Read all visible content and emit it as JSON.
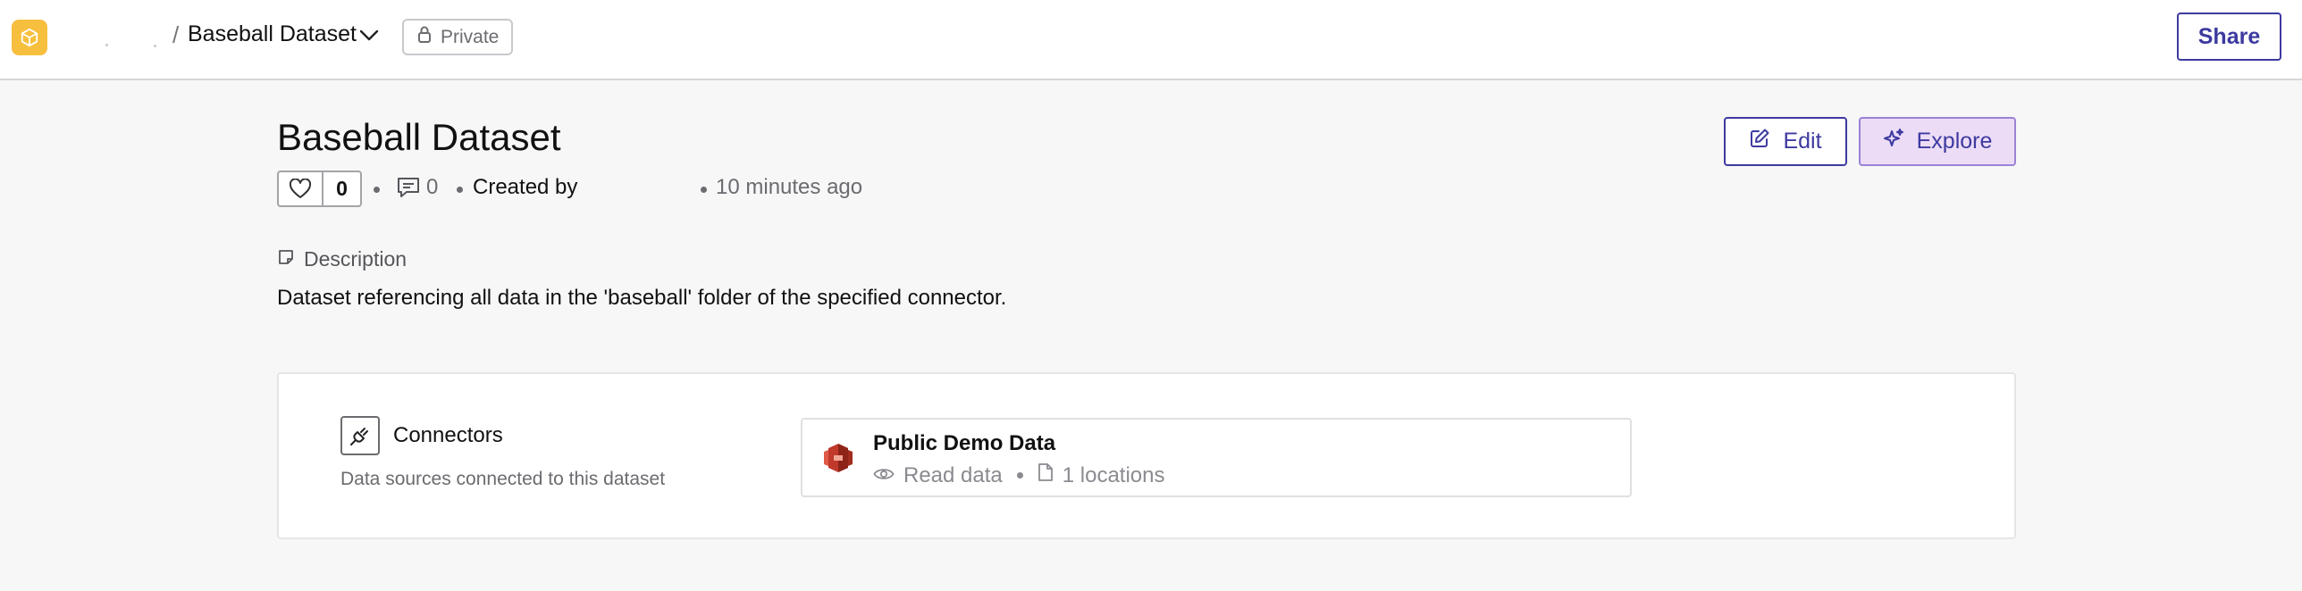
{
  "header": {
    "breadcrumb_separator": "/",
    "dataset_name": "Baseball Dataset",
    "visibility_label": "Private",
    "share_label": "Share"
  },
  "dataset": {
    "title": "Baseball Dataset",
    "like_count": "0",
    "comment_count": "0",
    "created_by_label": "Created by",
    "time_ago": "10 minutes ago",
    "edit_label": "Edit",
    "explore_label": "Explore",
    "description_label": "Description",
    "description_text": "Dataset referencing all data in the 'baseball' folder of the specified connector."
  },
  "connectors": {
    "title": "Connectors",
    "subtitle": "Data sources connected to this dataset",
    "items": [
      {
        "name": "Public Demo Data",
        "access": "Read data",
        "locations": "1 locations"
      }
    ]
  },
  "colors": {
    "accent": "#3d3aa0",
    "logo_bg": "#f7bf3e",
    "explore_bg": "#ecdcf6",
    "connector_logo": "#c0392b"
  }
}
